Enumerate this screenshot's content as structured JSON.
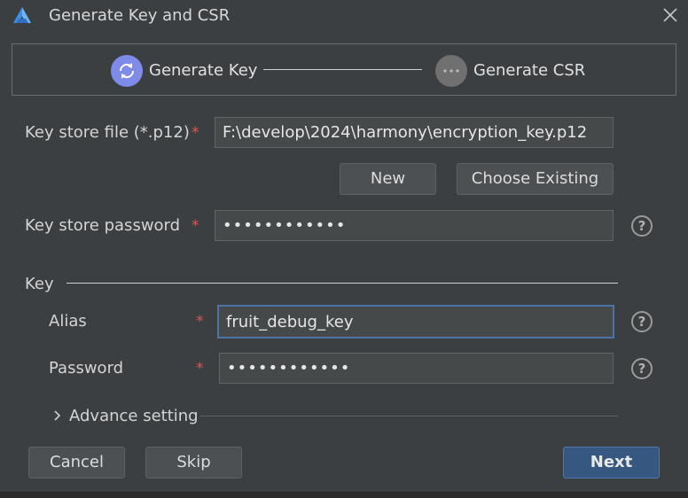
{
  "window": {
    "title": "Generate Key and CSR",
    "logo_icon": "harmony-logo-icon",
    "close_icon": "close-icon"
  },
  "stepper": {
    "steps": [
      {
        "label": "Generate Key",
        "state": "active",
        "icon": "sync-icon",
        "color": "#7e8be9"
      },
      {
        "label": "Generate CSR",
        "state": "pending",
        "icon": "ellipsis-icon",
        "color": "#707070"
      }
    ]
  },
  "keystore": {
    "file_label": "Key store file (*.p12)",
    "file_value": "F:\\develop\\2024\\harmony\\encryption_key.p12",
    "new_label": "New",
    "choose_label": "Choose Existing",
    "password_label": "Key store password",
    "password_value": "••••••••••••"
  },
  "key": {
    "section_label": "Key",
    "alias_label": "Alias",
    "alias_value": "fruit_debug_key",
    "password_label": "Password",
    "password_value": "••••••••••••",
    "advance_label": "Advance setting"
  },
  "required_mark": "*",
  "help_glyph": "?",
  "footer": {
    "cancel_label": "Cancel",
    "skip_label": "Skip",
    "next_label": "Next"
  }
}
